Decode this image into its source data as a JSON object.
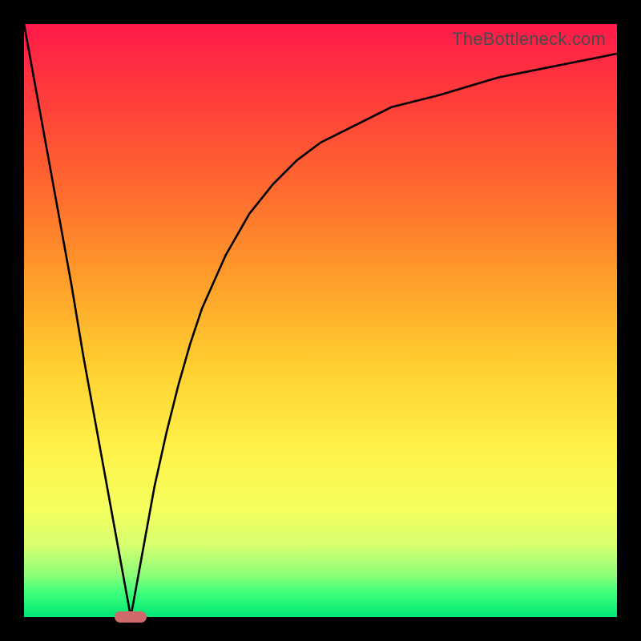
{
  "watermark": "TheBottleneck.com",
  "colors": {
    "frame": "#000000",
    "curve_stroke": "#000000",
    "marker_fill": "#cf6a6a",
    "gradient_top": "#ff1a4a",
    "gradient_bottom": "#00e676"
  },
  "chart_data": {
    "type": "line",
    "title": "",
    "xlabel": "",
    "ylabel": "",
    "xlim": [
      0,
      100
    ],
    "ylim": [
      0,
      100
    ],
    "grid": false,
    "background": "red-yellow-green vertical gradient",
    "series": [
      {
        "name": "left-branch",
        "x": [
          0,
          2,
          4,
          6,
          8,
          10,
          12,
          14,
          16,
          18
        ],
        "values": [
          100,
          89,
          78,
          67,
          56,
          44,
          33,
          22,
          11,
          0
        ]
      },
      {
        "name": "right-branch",
        "x": [
          18,
          20,
          22,
          24,
          26,
          28,
          30,
          34,
          38,
          42,
          46,
          50,
          56,
          62,
          70,
          80,
          90,
          100
        ],
        "values": [
          0,
          11,
          22,
          31,
          39,
          46,
          52,
          61,
          68,
          73,
          77,
          80,
          83,
          86,
          88,
          91,
          93,
          95
        ]
      }
    ],
    "marker": {
      "x": 18,
      "y": 0,
      "label": ""
    }
  }
}
